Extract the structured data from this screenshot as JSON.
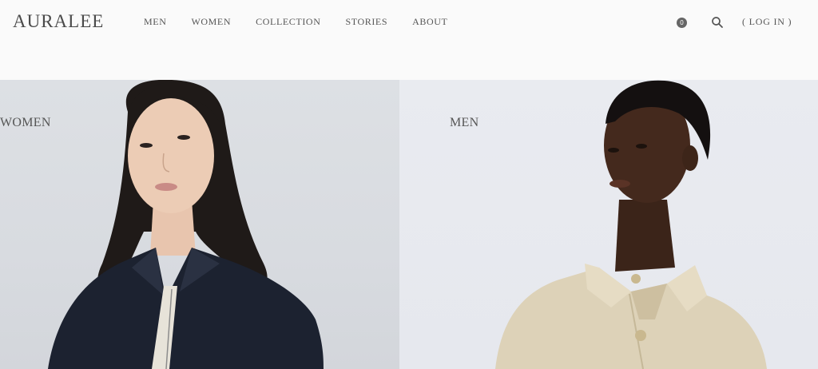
{
  "header": {
    "logo": "AURALEE",
    "nav": [
      "MEN",
      "WOMEN",
      "COLLECTION",
      "STORIES",
      "ABOUT"
    ],
    "cart_count": "0",
    "login_label": "( LOG IN )"
  },
  "icons": {
    "search": "search-icon",
    "cart": "cart-icon"
  },
  "panels": {
    "women": {
      "label": "WOMEN"
    },
    "men": {
      "label": "MEN"
    }
  },
  "colors": {
    "background": "#fafafa",
    "text": "#555555",
    "women_bg": "#dde0e4",
    "men_bg": "#e9ebf0"
  }
}
